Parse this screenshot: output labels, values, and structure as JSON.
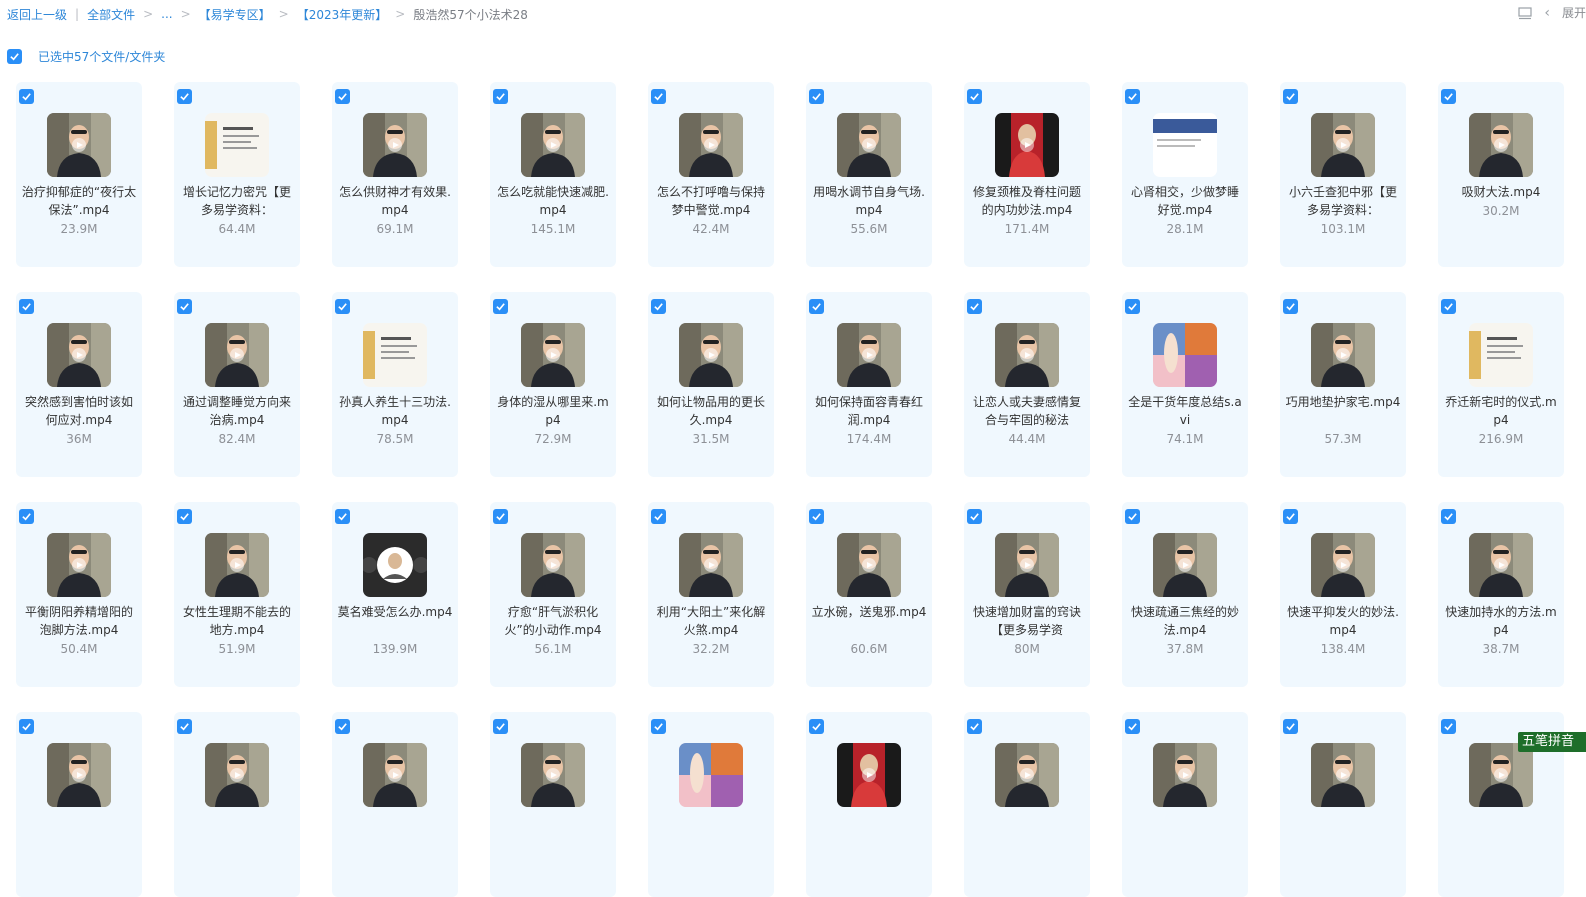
{
  "breadcrumb": {
    "back": "返回上一级",
    "all_files": "全部文件",
    "ellipsis": "...",
    "folder1": "【易学专区】",
    "folder2": "【2023年更新】",
    "current": "殷浩然57个小法术28",
    "sep1": "|",
    "arrow": ">"
  },
  "top_right": {
    "label": "展开"
  },
  "selection": {
    "text": "已选中57个文件/文件夹"
  },
  "ime_badge": "五笔拼音",
  "files": [
    {
      "name": "治疗抑郁症的“夜行太保法”.mp4",
      "size": "23.9M",
      "thumb": "person"
    },
    {
      "name": "增长记忆力密咒【更多易学资料：",
      "size": "64.4M",
      "thumb": "doc"
    },
    {
      "name": "怎么供财神才有效果.mp4",
      "size": "69.1M",
      "thumb": "person"
    },
    {
      "name": "怎么吃就能快速减肥.mp4",
      "size": "145.1M",
      "thumb": "person"
    },
    {
      "name": "怎么不打呼噜与保持梦中警觉.mp4",
      "size": "42.4M",
      "thumb": "person"
    },
    {
      "name": "用喝水调节自身气场.mp4",
      "size": "55.6M",
      "thumb": "person"
    },
    {
      "name": "修复颈椎及脊柱问题的内功妙法.mp4",
      "size": "171.4M",
      "thumb": "red"
    },
    {
      "name": "心肾相交，少做梦睡好觉.mp4",
      "size": "28.1M",
      "thumb": "doc2"
    },
    {
      "name": "小六壬查犯中邪【更多易学资料：",
      "size": "103.1M",
      "thumb": "person"
    },
    {
      "name": "吸财大法.mp4",
      "size": "30.2M",
      "thumb": "person",
      "short": true
    },
    {
      "name": "突然感到害怕时该如何应对.mp4",
      "size": "36M",
      "thumb": "person"
    },
    {
      "name": "通过调整睡觉方向来治病.mp4",
      "size": "82.4M",
      "thumb": "person"
    },
    {
      "name": "孙真人养生十三功法.mp4",
      "size": "78.5M",
      "thumb": "doc"
    },
    {
      "name": "身体的湿从哪里来.mp4",
      "size": "72.9M",
      "thumb": "person"
    },
    {
      "name": "如何让物品用的更长久.mp4",
      "size": "31.5M",
      "thumb": "person"
    },
    {
      "name": "如何保持面容青春红润.mp4",
      "size": "174.4M",
      "thumb": "person"
    },
    {
      "name": "让恋人或夫妻感情复合与牢固的秘法",
      "size": "44.4M",
      "thumb": "person"
    },
    {
      "name": "全是干货年度总结s.avi",
      "size": "74.1M",
      "thumb": "colorful"
    },
    {
      "name": "巧用地垫护家宅.mp4",
      "size": "57.3M",
      "thumb": "person"
    },
    {
      "name": "乔迁新宅时的仪式.mp4",
      "size": "216.9M",
      "thumb": "doc"
    },
    {
      "name": "平衡阴阳养精增阳的泡脚方法.mp4",
      "size": "50.4M",
      "thumb": "person"
    },
    {
      "name": "女性生理期不能去的地方.mp4",
      "size": "51.9M",
      "thumb": "person"
    },
    {
      "name": "莫名难受怎么办.mp4",
      "size": "139.9M",
      "thumb": "dark"
    },
    {
      "name": "疗愈“肝气淤积化火”的小动作.mp4",
      "size": "56.1M",
      "thumb": "person"
    },
    {
      "name": "利用“大阳土”来化解火煞.mp4",
      "size": "32.2M",
      "thumb": "person"
    },
    {
      "name": "立水碗，送鬼邪.mp4",
      "size": "60.6M",
      "thumb": "person"
    },
    {
      "name": "快速增加财富的窍诀【更多易学资",
      "size": "80M",
      "thumb": "person"
    },
    {
      "name": "快速疏通三焦经的妙法.mp4",
      "size": "37.8M",
      "thumb": "person"
    },
    {
      "name": "快速平抑发火的妙法.mp4",
      "size": "138.4M",
      "thumb": "person"
    },
    {
      "name": "快速加持水的方法.mp4",
      "size": "38.7M",
      "thumb": "person"
    },
    {
      "name": "",
      "size": "",
      "thumb": "person"
    },
    {
      "name": "",
      "size": "",
      "thumb": "person"
    },
    {
      "name": "",
      "size": "",
      "thumb": "person"
    },
    {
      "name": "",
      "size": "",
      "thumb": "person"
    },
    {
      "name": "",
      "size": "",
      "thumb": "colorful"
    },
    {
      "name": "",
      "size": "",
      "thumb": "red"
    },
    {
      "name": "",
      "size": "",
      "thumb": "person"
    },
    {
      "name": "",
      "size": "",
      "thumb": "person"
    },
    {
      "name": "",
      "size": "",
      "thumb": "person"
    },
    {
      "name": "",
      "size": "",
      "thumb": "person"
    }
  ]
}
